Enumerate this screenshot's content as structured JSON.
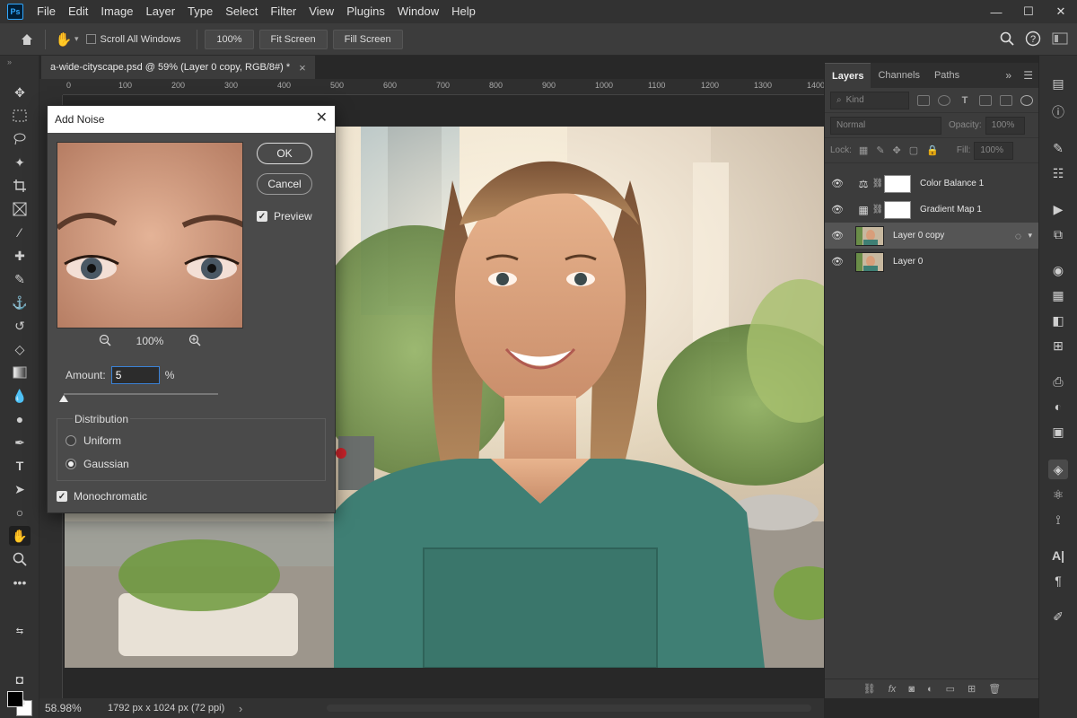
{
  "menubar": {
    "logo": "Ps",
    "items": [
      "File",
      "Edit",
      "Image",
      "Layer",
      "Type",
      "Select",
      "Filter",
      "View",
      "Plugins",
      "Window",
      "Help"
    ],
    "minimize": "—",
    "maximize": "☐",
    "close": "✕"
  },
  "options": {
    "scroll_all": "Scroll All Windows",
    "zoom_100": "100%",
    "fit_screen": "Fit Screen",
    "fill_screen": "Fill Screen"
  },
  "document": {
    "tab_title": "a-wide-cityscape.psd @ 59% (Layer 0 copy, RGB/8#) *",
    "tab_close": "×",
    "ruler_ticks": [
      "0",
      "100",
      "200",
      "300",
      "400",
      "500",
      "600",
      "700",
      "800",
      "900",
      "1000",
      "1100",
      "1200",
      "1300",
      "1400"
    ]
  },
  "status": {
    "zoom": "58.98%",
    "doc_size": "1792 px x 1024 px (72 ppi)",
    "arrow": "›"
  },
  "dialog": {
    "title": "Add Noise",
    "close": "✕",
    "ok": "OK",
    "cancel": "Cancel",
    "preview_label": "Preview",
    "preview_zoom": "100%",
    "amount_label": "Amount:",
    "amount_value": "5",
    "amount_unit": "%",
    "amount_fraction": 0.0,
    "distribution_label": "Distribution",
    "uniform_label": "Uniform",
    "gaussian_label": "Gaussian",
    "monochromatic_label": "Monochromatic",
    "selected_distribution": "gaussian"
  },
  "layers_panel": {
    "tabs": [
      "Layers",
      "Channels",
      "Paths"
    ],
    "active_tab": "Layers",
    "filter_placeholder": "Kind",
    "blend_mode": "Normal",
    "opacity_label": "Opacity:",
    "opacity_value": "100%",
    "lock_label": "Lock:",
    "fill_label": "Fill:",
    "fill_value": "100%",
    "layers": [
      {
        "name": "Color Balance 1",
        "kind": "adjustment",
        "icon": "⚖"
      },
      {
        "name": "Gradient Map 1",
        "kind": "adjustment",
        "icon": "▦"
      },
      {
        "name": "Layer 0 copy",
        "kind": "image",
        "selected": true
      },
      {
        "name": "Layer 0",
        "kind": "image"
      }
    ]
  },
  "colors": {
    "accent": "#31a8ff",
    "dialog_bg": "#4a4a4a",
    "panel_bg": "#3c3c3c",
    "canvas_bg": "#282828"
  }
}
